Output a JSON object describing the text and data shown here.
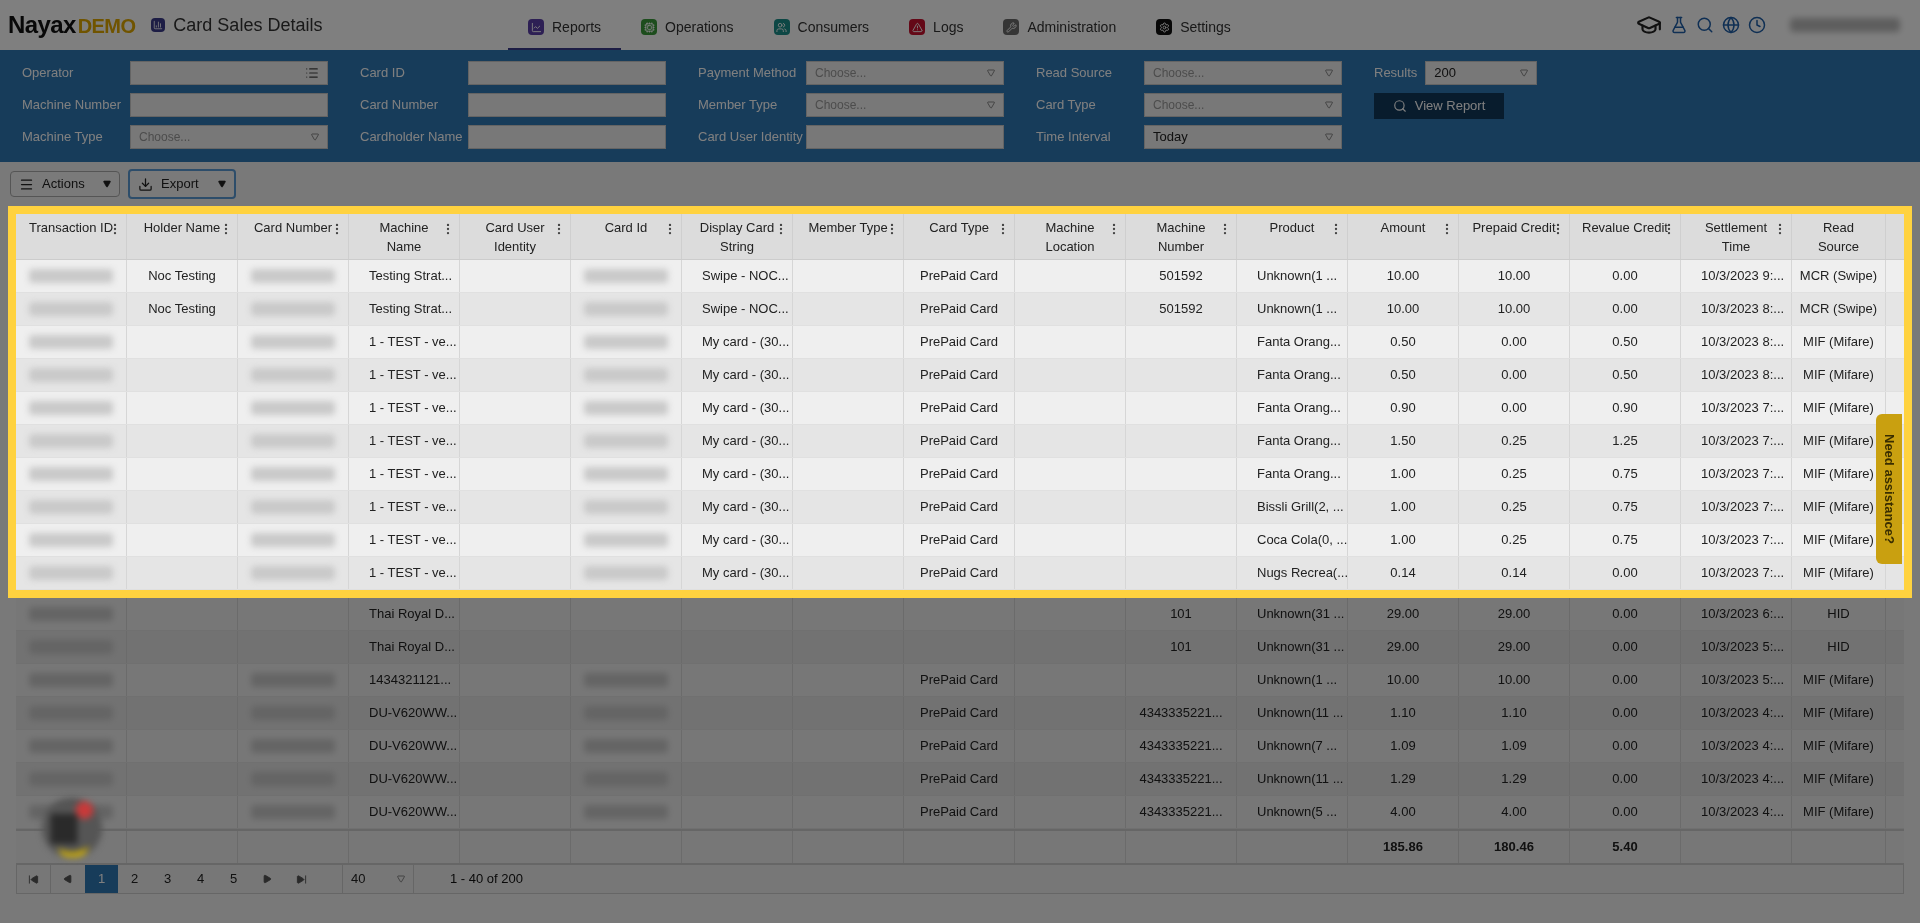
{
  "header": {
    "logo": {
      "brand": "Nayax",
      "suffix": "DEMO"
    },
    "page_title": "Card Sales Details",
    "nav": [
      {
        "label": "Reports",
        "selected": true
      },
      {
        "label": "Operations",
        "selected": false
      },
      {
        "label": "Consumers",
        "selected": false
      },
      {
        "label": "Logs",
        "selected": false
      },
      {
        "label": "Administration",
        "selected": false
      },
      {
        "label": "Settings",
        "selected": false
      }
    ]
  },
  "filters": {
    "columns": [
      [
        {
          "label": "Operator",
          "kind": "list"
        },
        {
          "label": "Machine Number",
          "kind": "text"
        },
        {
          "label": "Machine Type",
          "kind": "select",
          "placeholder": "Choose..."
        }
      ],
      [
        {
          "label": "Card ID",
          "kind": "text"
        },
        {
          "label": "Card Number",
          "kind": "text"
        },
        {
          "label": "Cardholder Name",
          "kind": "text"
        }
      ],
      [
        {
          "label": "Payment Method",
          "kind": "select",
          "placeholder": "Choose..."
        },
        {
          "label": "Member Type",
          "kind": "select",
          "placeholder": "Choose..."
        },
        {
          "label": "Card User Identity",
          "kind": "text"
        }
      ],
      [
        {
          "label": "Read Source",
          "kind": "select",
          "placeholder": "Choose..."
        },
        {
          "label": "Card Type",
          "kind": "select",
          "placeholder": "Choose..."
        },
        {
          "label": "Time Interval",
          "kind": "select",
          "value": "Today"
        }
      ]
    ],
    "results": {
      "label": "Results",
      "value": "200"
    },
    "view_button": "View Report"
  },
  "toolbar": {
    "actions": "Actions",
    "export": "Export"
  },
  "table": {
    "columns": [
      {
        "label": "Transaction ID",
        "menu": true
      },
      {
        "label": "Holder Name",
        "menu": true
      },
      {
        "label": "Card Number",
        "menu": true
      },
      {
        "label": "Machine Name",
        "menu": true
      },
      {
        "label": "Card User Identity",
        "menu": true
      },
      {
        "label": "Card Id",
        "menu": true
      },
      {
        "label": "Display Card String",
        "menu": true
      },
      {
        "label": "Member Type",
        "menu": true
      },
      {
        "label": "Card Type",
        "menu": true
      },
      {
        "label": "Machine Location",
        "menu": true
      },
      {
        "label": "Machine Number",
        "menu": true
      },
      {
        "label": "Product",
        "menu": true
      },
      {
        "label": "Amount",
        "menu": true
      },
      {
        "label": "Prepaid Credit",
        "menu": true
      },
      {
        "label": "Revalue Credit",
        "menu": true
      },
      {
        "label": "Settlement Time",
        "menu": true
      },
      {
        "label": "Read Source",
        "menu": false
      }
    ],
    "rows": [
      {
        "highlighted": true,
        "cells": [
          {
            "kind": "blurred"
          },
          "Noc Testing",
          {
            "kind": "blurred"
          },
          "Testing Strat...",
          null,
          {
            "kind": "blurred"
          },
          "Swipe - NOC...",
          null,
          "PrePaid Card",
          null,
          "501592",
          "Unknown(1 ...",
          "10.00",
          "10.00",
          "0.00",
          "10/3/2023 9:...",
          "MCR (Swipe)"
        ]
      },
      {
        "highlighted": true,
        "cells": [
          {
            "kind": "blurred"
          },
          "Noc Testing",
          {
            "kind": "blurred"
          },
          "Testing Strat...",
          null,
          {
            "kind": "blurred"
          },
          "Swipe - NOC...",
          null,
          "PrePaid Card",
          null,
          "501592",
          "Unknown(1 ...",
          "10.00",
          "10.00",
          "0.00",
          "10/3/2023 8:...",
          "MCR (Swipe)"
        ]
      },
      {
        "highlighted": true,
        "cells": [
          {
            "kind": "blurred"
          },
          null,
          {
            "kind": "blurred"
          },
          "1 - TEST - ve...",
          null,
          {
            "kind": "blurred"
          },
          "My card - (30...",
          null,
          "PrePaid Card",
          null,
          null,
          "Fanta Orang...",
          "0.50",
          "0.00",
          "0.50",
          "10/3/2023 8:...",
          "MIF (Mifare)"
        ]
      },
      {
        "highlighted": true,
        "cells": [
          {
            "kind": "blurred"
          },
          null,
          {
            "kind": "blurred"
          },
          "1 - TEST - ve...",
          null,
          {
            "kind": "blurred"
          },
          "My card - (30...",
          null,
          "PrePaid Card",
          null,
          null,
          "Fanta Orang...",
          "0.50",
          "0.00",
          "0.50",
          "10/3/2023 8:...",
          "MIF (Mifare)"
        ]
      },
      {
        "highlighted": true,
        "cells": [
          {
            "kind": "blurred"
          },
          null,
          {
            "kind": "blurred"
          },
          "1 - TEST - ve...",
          null,
          {
            "kind": "blurred"
          },
          "My card - (30...",
          null,
          "PrePaid Card",
          null,
          null,
          "Fanta Orang...",
          "0.90",
          "0.00",
          "0.90",
          "10/3/2023 7:...",
          "MIF (Mifare)"
        ]
      },
      {
        "highlighted": true,
        "cells": [
          {
            "kind": "blurred"
          },
          null,
          {
            "kind": "blurred"
          },
          "1 - TEST - ve...",
          null,
          {
            "kind": "blurred"
          },
          "My card - (30...",
          null,
          "PrePaid Card",
          null,
          null,
          "Fanta Orang...",
          "1.50",
          "0.25",
          "1.25",
          "10/3/2023 7:...",
          "MIF (Mifare)"
        ]
      },
      {
        "highlighted": true,
        "cells": [
          {
            "kind": "blurred"
          },
          null,
          {
            "kind": "blurred"
          },
          "1 - TEST - ve...",
          null,
          {
            "kind": "blurred"
          },
          "My card - (30...",
          null,
          "PrePaid Card",
          null,
          null,
          "Fanta Orang...",
          "1.00",
          "0.25",
          "0.75",
          "10/3/2023 7:...",
          "MIF (Mifare)"
        ]
      },
      {
        "highlighted": true,
        "cells": [
          {
            "kind": "blurred"
          },
          null,
          {
            "kind": "blurred"
          },
          "1 - TEST - ve...",
          null,
          {
            "kind": "blurred"
          },
          "My card - (30...",
          null,
          "PrePaid Card",
          null,
          null,
          "Bissli Grill(2, ...",
          "1.00",
          "0.25",
          "0.75",
          "10/3/2023 7:...",
          "MIF (Mifare)"
        ]
      },
      {
        "highlighted": true,
        "cells": [
          {
            "kind": "blurred"
          },
          null,
          {
            "kind": "blurred"
          },
          "1 - TEST - ve...",
          null,
          {
            "kind": "blurred"
          },
          "My card - (30...",
          null,
          "PrePaid Card",
          null,
          null,
          "Coca Cola(0, ...",
          "1.00",
          "0.25",
          "0.75",
          "10/3/2023 7:...",
          "MIF (Mifare)"
        ]
      },
      {
        "highlighted": true,
        "cells": [
          {
            "kind": "blurred"
          },
          null,
          {
            "kind": "blurred"
          },
          "1 - TEST - ve...",
          null,
          {
            "kind": "blurred"
          },
          "My card - (30...",
          null,
          "PrePaid Card",
          null,
          null,
          "Nugs Recrea(...",
          "0.14",
          "0.14",
          "0.00",
          "10/3/2023 7:...",
          "MIF (Mifare)"
        ]
      },
      {
        "highlighted": false,
        "cells": [
          {
            "kind": "blurred"
          },
          null,
          null,
          "Thai Royal D...",
          null,
          null,
          null,
          null,
          null,
          null,
          "101",
          "Unknown(31 ...",
          "29.00",
          "29.00",
          "0.00",
          "10/3/2023 6:...",
          "HID"
        ]
      },
      {
        "highlighted": false,
        "cells": [
          {
            "kind": "blurred"
          },
          null,
          null,
          "Thai Royal D...",
          null,
          null,
          null,
          null,
          null,
          null,
          "101",
          "Unknown(31 ...",
          "29.00",
          "29.00",
          "0.00",
          "10/3/2023 5:...",
          "HID"
        ]
      },
      {
        "highlighted": false,
        "cells": [
          {
            "kind": "blurred"
          },
          null,
          {
            "kind": "blurred"
          },
          "1434321121...",
          null,
          {
            "kind": "blurred"
          },
          null,
          null,
          "PrePaid Card",
          null,
          null,
          "Unknown(1 ...",
          "10.00",
          "10.00",
          "0.00",
          "10/3/2023 5:...",
          "MIF (Mifare)"
        ]
      },
      {
        "highlighted": false,
        "cells": [
          {
            "kind": "blurred"
          },
          null,
          {
            "kind": "blurred"
          },
          "DU-V620WW...",
          null,
          {
            "kind": "blurred"
          },
          null,
          null,
          "PrePaid Card",
          null,
          "4343335221...",
          "Unknown(11 ...",
          "1.10",
          "1.10",
          "0.00",
          "10/3/2023 4:...",
          "MIF (Mifare)"
        ]
      },
      {
        "highlighted": false,
        "cells": [
          {
            "kind": "blurred"
          },
          null,
          {
            "kind": "blurred"
          },
          "DU-V620WW...",
          null,
          {
            "kind": "blurred"
          },
          null,
          null,
          "PrePaid Card",
          null,
          "4343335221...",
          "Unknown(7 ...",
          "1.09",
          "1.09",
          "0.00",
          "10/3/2023 4:...",
          "MIF (Mifare)"
        ]
      },
      {
        "highlighted": false,
        "cells": [
          {
            "kind": "blurred"
          },
          null,
          {
            "kind": "blurred"
          },
          "DU-V620WW...",
          null,
          {
            "kind": "blurred"
          },
          null,
          null,
          "PrePaid Card",
          null,
          "4343335221...",
          "Unknown(11 ...",
          "1.29",
          "1.29",
          "0.00",
          "10/3/2023 4:...",
          "MIF (Mifare)"
        ]
      },
      {
        "highlighted": false,
        "cells": [
          {
            "kind": "blurred"
          },
          null,
          {
            "kind": "blurred"
          },
          "DU-V620WW...",
          null,
          {
            "kind": "blurred"
          },
          null,
          null,
          "PrePaid Card",
          null,
          "4343335221...",
          "Unknown(5 ...",
          "4.00",
          "4.00",
          "0.00",
          "10/3/2023 4:...",
          "MIF (Mifare)"
        ]
      }
    ],
    "totals": {
      "amount": "185.86",
      "prepaid_credit": "180.46",
      "revalue_credit": "5.40"
    }
  },
  "pagination": {
    "pages": [
      {
        "label": "1",
        "selected": true
      },
      {
        "label": "2",
        "selected": false
      },
      {
        "label": "3",
        "selected": false
      },
      {
        "label": "4",
        "selected": false
      },
      {
        "label": "5",
        "selected": false
      }
    ],
    "page_size": "40",
    "summary": "1 - 40 of 200"
  },
  "help_tab": "Need assistance?"
}
